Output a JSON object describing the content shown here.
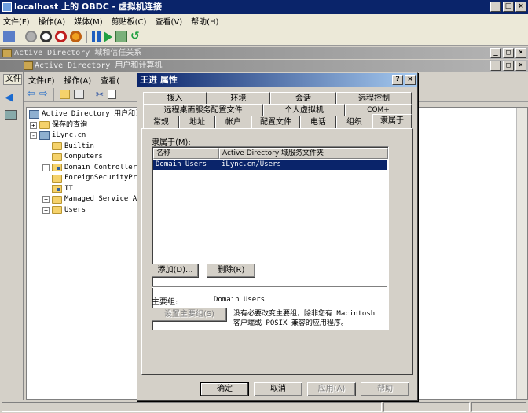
{
  "vm": {
    "title": "localhost 上的 OBDC - 虚拟机连接",
    "menu": [
      "文件(F)",
      "操作(A)",
      "媒体(M)",
      "剪贴板(C)",
      "查看(V)",
      "帮助(H)"
    ]
  },
  "trust_window": {
    "title": "Active Directory 域和信任关系"
  },
  "aduc": {
    "title": "Active Directory 用户和计算机",
    "left_tab": "文件",
    "menu": [
      "文件(F)",
      "操作(A)",
      "查看("
    ],
    "tree": [
      {
        "label": "Active Directory 用户和计",
        "indent": 0,
        "expander": "",
        "icon": "ad"
      },
      {
        "label": "保存的查询",
        "indent": 1,
        "expander": "+",
        "icon": "folder"
      },
      {
        "label": "iLync.cn",
        "indent": 1,
        "expander": "-",
        "icon": "domain"
      },
      {
        "label": "Builtin",
        "indent": 2,
        "expander": "",
        "icon": "folder"
      },
      {
        "label": "Computers",
        "indent": 2,
        "expander": "",
        "icon": "folder"
      },
      {
        "label": "Domain Controllers",
        "indent": 2,
        "expander": "+",
        "icon": "ou"
      },
      {
        "label": "ForeignSecurityPri",
        "indent": 2,
        "expander": "",
        "icon": "folder"
      },
      {
        "label": "IT",
        "indent": 2,
        "expander": "",
        "icon": "ou"
      },
      {
        "label": "Managed Service Ac",
        "indent": 2,
        "expander": "+",
        "icon": "folder"
      },
      {
        "label": "Users",
        "indent": 2,
        "expander": "+",
        "icon": "folder"
      }
    ]
  },
  "dialog": {
    "title": "王进 属性",
    "tabs_row1": [
      "拨入",
      "环境",
      "会话",
      "远程控制"
    ],
    "tabs_row2": [
      "远程桌面服务配置文件",
      "个人虚拟机",
      "COM+"
    ],
    "tabs_row3": [
      "常规",
      "地址",
      "帐户",
      "配置文件",
      "电话",
      "组织",
      "隶属于"
    ],
    "member_of_label": "隶属于(M):",
    "columns": [
      "名称",
      "Active Directory 域服务文件夹"
    ],
    "rows": [
      {
        "name": "Domain Users",
        "folder": "iLync.cn/Users"
      }
    ],
    "add_button": "添加(D)...",
    "remove_button": "删除(R)",
    "primary_group_label": "主要组:",
    "primary_group_value": "Domain Users",
    "set_primary_button": "设置主要组(S)",
    "note_line1": "没有必要改变主要组，除非您有 Macintosh",
    "note_line2": "客户端或 POSIX 兼容的应用程序。",
    "ok_button": "确定",
    "cancel_button": "取消",
    "apply_button": "应用(A)",
    "help_button": "帮助"
  }
}
